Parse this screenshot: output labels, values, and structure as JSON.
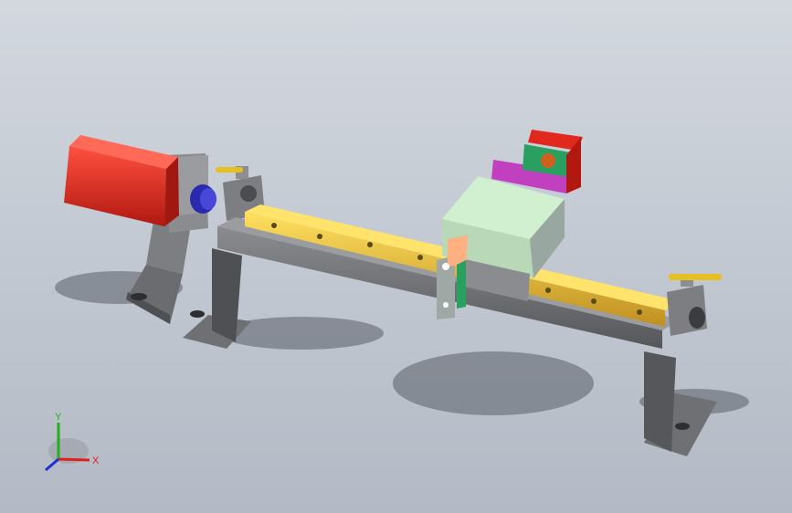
{
  "triad": {
    "x_label": "X",
    "y_label": "Y",
    "z_label": "Z",
    "x_color": "#e02020",
    "y_color": "#20b020",
    "z_color": "#2030d0"
  },
  "colors": {
    "motor": "#e8281e",
    "frame": "#6c6e72",
    "rail": "#e8c22a",
    "carriage": "#d0f0d0",
    "cylinder": "#c040c0",
    "block_green": "#2aa060",
    "coupler": "#2a2ab0"
  }
}
